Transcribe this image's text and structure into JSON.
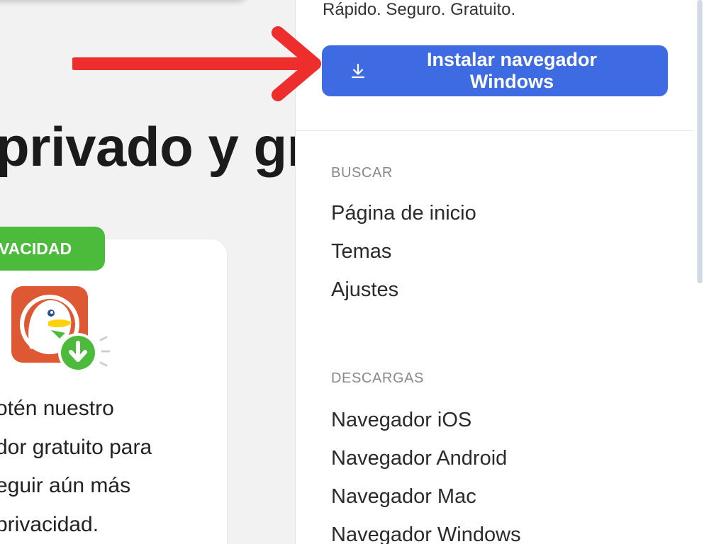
{
  "colors": {
    "accent_blue": "#3f6be2",
    "privacy_green": "#4cbb3c",
    "arrow_red": "#ee2d2d",
    "duck_orange": "#de5833"
  },
  "hero": {
    "title": "privado y gr"
  },
  "promo": {
    "badge": "VACIDAD",
    "icon": "duckduckgo-download-icon",
    "text": "otén nuestro\ndor gratuito para\neguir aún más\nprivacidad."
  },
  "menu": {
    "tagline": "Rápido. Seguro. Gratuito.",
    "install_button": {
      "icon": "download-icon",
      "label": "Instalar navegador\nWindows"
    },
    "sections": [
      {
        "heading": "BUSCAR",
        "items": [
          "Página de inicio",
          "Temas",
          "Ajustes"
        ]
      },
      {
        "heading": "DESCARGAS",
        "items": [
          "Navegador iOS",
          "Navegador Android",
          "Navegador Mac",
          "Navegador Windows"
        ]
      }
    ]
  }
}
